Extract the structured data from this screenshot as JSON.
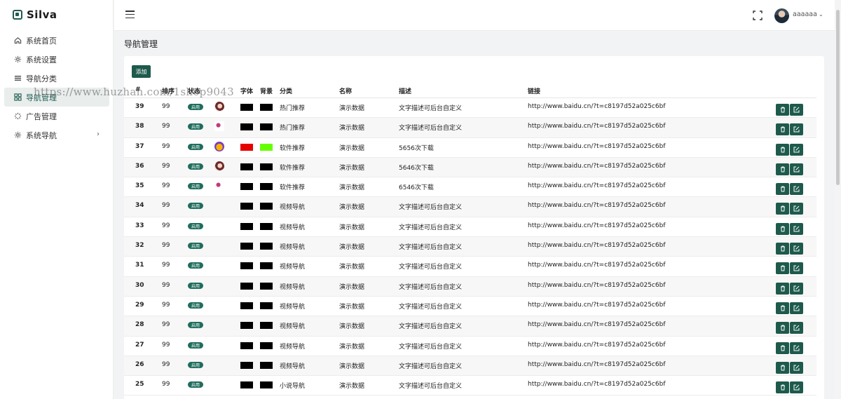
{
  "app": {
    "logo_text": "Silva"
  },
  "sidebar": {
    "items": [
      {
        "label": "系统首页",
        "icon": "home-icon"
      },
      {
        "label": "系统设置",
        "icon": "gear-icon"
      },
      {
        "label": "导航分类",
        "icon": "list-icon"
      },
      {
        "label": "导航管理",
        "icon": "grid-icon",
        "active": true
      },
      {
        "label": "广告管理",
        "icon": "loader-icon"
      },
      {
        "label": "系统导航",
        "icon": "gear-icon",
        "has_children": true
      }
    ]
  },
  "header": {
    "user_name": "aaaaaa"
  },
  "page": {
    "title": "导航管理",
    "add_label": "添加"
  },
  "watermark": "https://www.huzhan.com/1shop9043",
  "table": {
    "headers": [
      "#",
      "排序",
      "状态",
      "字体",
      "背景",
      "分类",
      "名称",
      "描述",
      "链接"
    ],
    "rows": [
      {
        "id": "39",
        "sort": "99",
        "status": "启用",
        "icon": "girl1",
        "font_color": "#000000",
        "bg_color": "#000000",
        "category": "热门推荐",
        "name": "演示数据",
        "desc": "文字描述可后台自定义",
        "link": "http://www.baidu.cn/?t=c8197d52a025c6bf"
      },
      {
        "id": "38",
        "sort": "99",
        "status": "启用",
        "icon": "girl2",
        "font_color": "#000000",
        "bg_color": "#000000",
        "category": "热门推荐",
        "name": "演示数据",
        "desc": "文字描述可后台自定义",
        "link": "http://www.baidu.cn/?t=c8197d52a025c6bf"
      },
      {
        "id": "37",
        "sort": "99",
        "status": "启用",
        "icon": "emoji",
        "font_color": "#e60000",
        "bg_color": "#66ff00",
        "category": "软件推荐",
        "name": "演示数据",
        "desc": "5656次下载",
        "link": "http://www.baidu.cn/?t=c8197d52a025c6bf"
      },
      {
        "id": "36",
        "sort": "99",
        "status": "启用",
        "icon": "girl1",
        "font_color": "#000000",
        "bg_color": "#000000",
        "category": "软件推荐",
        "name": "演示数据",
        "desc": "5646次下载",
        "link": "http://www.baidu.cn/?t=c8197d52a025c6bf"
      },
      {
        "id": "35",
        "sort": "99",
        "status": "启用",
        "icon": "girl2",
        "font_color": "#000000",
        "bg_color": "#000000",
        "category": "软件推荐",
        "name": "演示数据",
        "desc": "6546次下载",
        "link": "http://www.baidu.cn/?t=c8197d52a025c6bf"
      },
      {
        "id": "34",
        "sort": "99",
        "status": "启用",
        "icon": "",
        "font_color": "#000000",
        "bg_color": "#000000",
        "category": "视频导航",
        "name": "演示数据",
        "desc": "文字描述可后台自定义",
        "link": "http://www.baidu.cn/?t=c8197d52a025c6bf"
      },
      {
        "id": "33",
        "sort": "99",
        "status": "启用",
        "icon": "",
        "font_color": "#000000",
        "bg_color": "#000000",
        "category": "视频导航",
        "name": "演示数据",
        "desc": "文字描述可后台自定义",
        "link": "http://www.baidu.cn/?t=c8197d52a025c6bf"
      },
      {
        "id": "32",
        "sort": "99",
        "status": "启用",
        "icon": "",
        "font_color": "#000000",
        "bg_color": "#000000",
        "category": "视频导航",
        "name": "演示数据",
        "desc": "文字描述可后台自定义",
        "link": "http://www.baidu.cn/?t=c8197d52a025c6bf"
      },
      {
        "id": "31",
        "sort": "99",
        "status": "启用",
        "icon": "",
        "font_color": "#000000",
        "bg_color": "#000000",
        "category": "视频导航",
        "name": "演示数据",
        "desc": "文字描述可后台自定义",
        "link": "http://www.baidu.cn/?t=c8197d52a025c6bf"
      },
      {
        "id": "30",
        "sort": "99",
        "status": "启用",
        "icon": "",
        "font_color": "#000000",
        "bg_color": "#000000",
        "category": "视频导航",
        "name": "演示数据",
        "desc": "文字描述可后台自定义",
        "link": "http://www.baidu.cn/?t=c8197d52a025c6bf"
      },
      {
        "id": "29",
        "sort": "99",
        "status": "启用",
        "icon": "",
        "font_color": "#000000",
        "bg_color": "#000000",
        "category": "视频导航",
        "name": "演示数据",
        "desc": "文字描述可后台自定义",
        "link": "http://www.baidu.cn/?t=c8197d52a025c6bf"
      },
      {
        "id": "28",
        "sort": "99",
        "status": "启用",
        "icon": "",
        "font_color": "#000000",
        "bg_color": "#000000",
        "category": "视频导航",
        "name": "演示数据",
        "desc": "文字描述可后台自定义",
        "link": "http://www.baidu.cn/?t=c8197d52a025c6bf"
      },
      {
        "id": "27",
        "sort": "99",
        "status": "启用",
        "icon": "",
        "font_color": "#000000",
        "bg_color": "#000000",
        "category": "视频导航",
        "name": "演示数据",
        "desc": "文字描述可后台自定义",
        "link": "http://www.baidu.cn/?t=c8197d52a025c6bf"
      },
      {
        "id": "26",
        "sort": "99",
        "status": "启用",
        "icon": "",
        "font_color": "#000000",
        "bg_color": "#000000",
        "category": "视频导航",
        "name": "演示数据",
        "desc": "文字描述可后台自定义",
        "link": "http://www.baidu.cn/?t=c8197d52a025c6bf"
      },
      {
        "id": "25",
        "sort": "99",
        "status": "启用",
        "icon": "",
        "font_color": "#000000",
        "bg_color": "#000000",
        "category": "小说导航",
        "name": "演示数据",
        "desc": "文字描述可后台自定义",
        "link": "http://www.baidu.cn/?t=c8197d52a025c6bf"
      }
    ]
  },
  "colors": {
    "accent": "#1e5a4c",
    "active_bg": "#e9eeed"
  }
}
